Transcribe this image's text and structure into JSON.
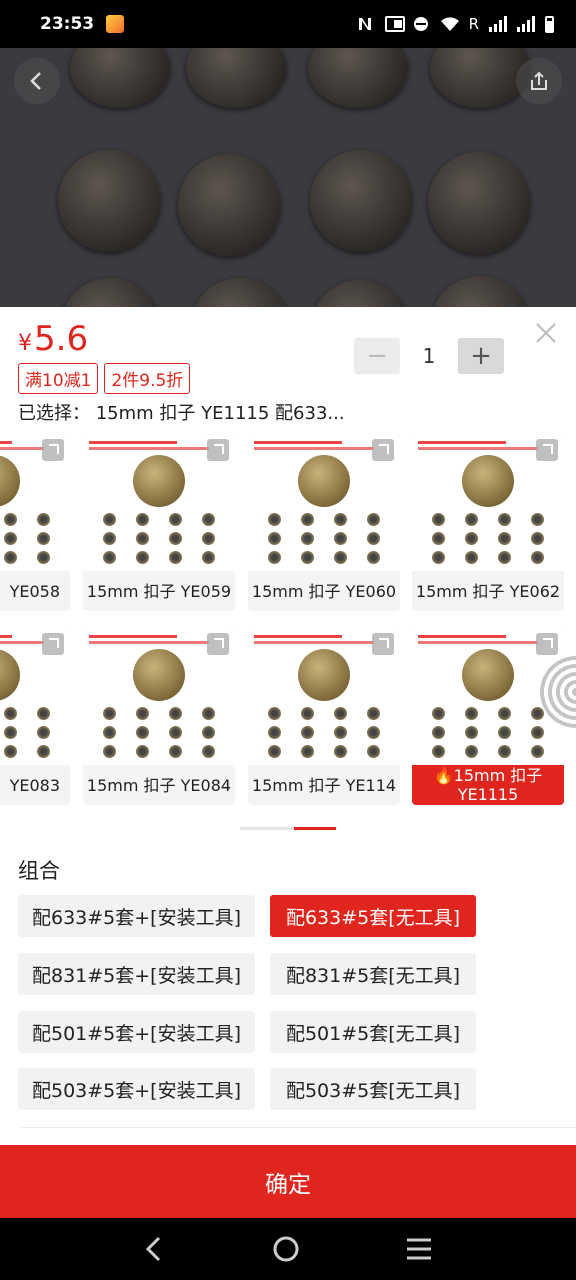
{
  "status": {
    "time": "23:53",
    "carrier_letter": "R"
  },
  "price": {
    "currency": "¥",
    "amount": "5.6"
  },
  "tags": [
    "满10减1",
    "2件9.5折"
  ],
  "quantity": {
    "value": "1",
    "minus": "−",
    "plus": "+"
  },
  "selected_text": "已选择：  15mm 扣子 YE1115 配633...",
  "variants": [
    {
      "label": "YE058"
    },
    {
      "label": "15mm 扣子 YE059"
    },
    {
      "label": "15mm 扣子 YE060"
    },
    {
      "label": "15mm 扣子 YE062"
    },
    {
      "label": "YE083"
    },
    {
      "label": "15mm 扣子 YE084"
    },
    {
      "label": "15mm 扣子 YE114"
    },
    {
      "label_line1": "🔥15mm 扣子",
      "label_line2": "YE1115",
      "selected": true
    }
  ],
  "combo": {
    "title": "组合",
    "options": [
      "配633#5套+[安装工具]",
      "配633#5套[无工具]",
      "配831#5套+[安装工具]",
      "配831#5套[无工具]",
      "配501#5套+[安装工具]",
      "配501#5套[无工具]",
      "配503#5套+[安装工具]",
      "配503#5套[无工具]"
    ],
    "selected_index": 1
  },
  "confirm_label": "确定",
  "colors": {
    "accent": "#e0251e",
    "text": "#222222"
  },
  "icons": [
    "back-arrow-icon",
    "share-icon",
    "close-icon",
    "expand-icon",
    "fire-icon",
    "nav-back-icon",
    "nav-home-icon",
    "nav-recent-icon"
  ]
}
